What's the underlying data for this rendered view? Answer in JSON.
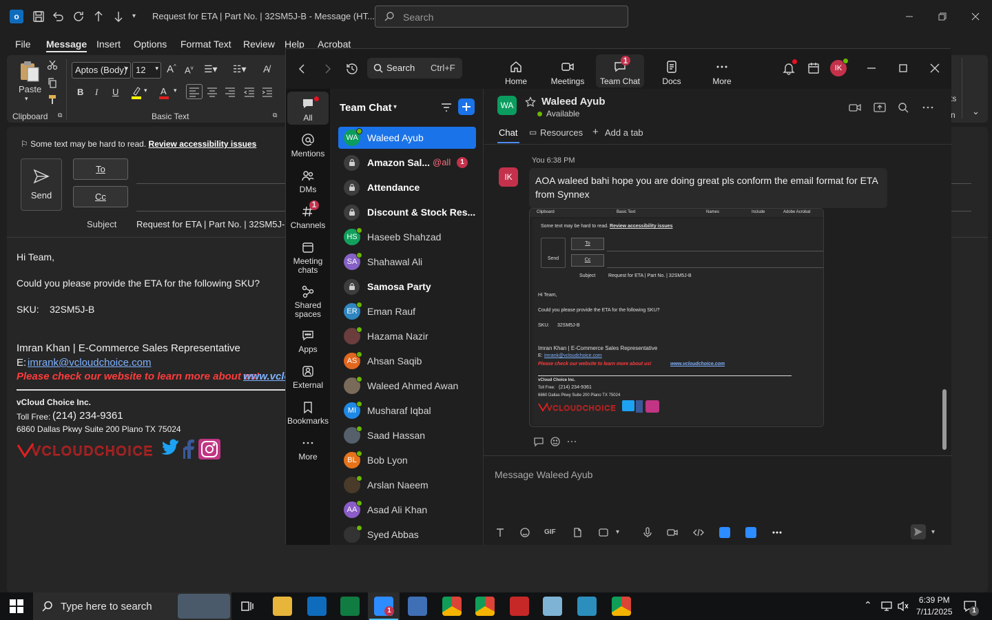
{
  "outlook": {
    "title": "Request for ETA | Part No. | 32SM5J-B  -  Message (HT...",
    "search_placeholder": "Search",
    "menu": [
      "File",
      "Message",
      "Insert",
      "Options",
      "Format Text",
      "Review",
      "Help",
      "Acrobat"
    ],
    "ribbon": {
      "paste": "Paste",
      "clipboard_group": "Clipboard",
      "basic_text_group": "Basic Text",
      "font_name": "Aptos (Body)",
      "font_size": "12",
      "right_partial": "ts",
      "right_partial2": "n"
    },
    "compose": {
      "accessibility_text": "Some text may be hard to read.",
      "accessibility_link": "Review accessibility issues",
      "send": "Send",
      "to": "To",
      "cc": "Cc",
      "subject_label": "Subject",
      "subject_value": "Request for ETA | Part No. | 32SM5J-B",
      "greeting": "Hi Team,",
      "line1": "Could you please provide the ETA for the following SKU?",
      "sku_label": "SKU:",
      "sku_value": "32SM5J-B",
      "sig_name": "Imran Khan | E-Commerce Sales Representative",
      "sig_email_label": "E:",
      "sig_email": "imrank@vcloudchoice.com",
      "sig_promo": "Please check our website to learn more about us!",
      "sig_url": "www.vclo",
      "company": "vCloud Choice Inc.",
      "toll_label": "Toll Free:",
      "toll_number": "(214) 234-9361",
      "address": "6860 Dallas Pkwy Suite 200 Plano TX 75024",
      "logo_text": "VCLOUDCHOICE"
    }
  },
  "teams": {
    "search": {
      "label": "Search",
      "shortcut": "Ctrl+F"
    },
    "apps": [
      {
        "label": "Home",
        "icon": "home-icon"
      },
      {
        "label": "Meetings",
        "icon": "video-icon"
      },
      {
        "label": "Team Chat",
        "icon": "chat-icon",
        "badge": "1"
      },
      {
        "label": "Docs",
        "icon": "doc-icon"
      },
      {
        "label": "More",
        "icon": "more-icon"
      }
    ],
    "profile_initials": "IK",
    "rail": [
      {
        "label": "All",
        "icon": "chat-icon"
      },
      {
        "label": "Mentions",
        "icon": "at-icon"
      },
      {
        "label": "DMs",
        "icon": "people-icon"
      },
      {
        "label": "Channels",
        "icon": "hash-icon",
        "badge": "1"
      },
      {
        "label": "Meeting chats",
        "icon": "calendar-icon"
      },
      {
        "label": "Shared spaces",
        "icon": "share-icon"
      },
      {
        "label": "Apps",
        "icon": "apps-icon"
      },
      {
        "label": "External",
        "icon": "external-icon"
      },
      {
        "label": "Bookmarks",
        "icon": "bookmark-icon"
      },
      {
        "label": "More",
        "icon": "more-icon"
      }
    ],
    "chat_list_title": "Team Chat",
    "chats": [
      {
        "name": "Waleed Ayub",
        "initials": "WA",
        "color": "#0b9d5f",
        "type": "person",
        "selected": true
      },
      {
        "name": "Amazon Sal...",
        "type": "channel",
        "bold": true,
        "mention": "@all",
        "badge": "1"
      },
      {
        "name": "Attendance",
        "type": "channel",
        "bold": true
      },
      {
        "name": "Discount & Stock Res...",
        "type": "channel",
        "bold": true
      },
      {
        "name": "Haseeb Shahzad",
        "initials": "HS",
        "color": "#12a05c",
        "type": "person"
      },
      {
        "name": "Shahawal Ali",
        "initials": "SA",
        "color": "#8661c5",
        "type": "person"
      },
      {
        "name": "Samosa Party",
        "type": "channel",
        "bold": true
      },
      {
        "name": "Eman Rauf",
        "initials": "ER",
        "color": "#2e86c1",
        "type": "person"
      },
      {
        "name": "Hazama Nazir",
        "initials": "",
        "color": "#6b3d3d",
        "type": "person"
      },
      {
        "name": "Ahsan Saqib",
        "initials": "AS",
        "color": "#e1671f",
        "type": "person"
      },
      {
        "name": "Waleed Ahmed Awan",
        "initials": "",
        "color": "#7a6a5a",
        "type": "person"
      },
      {
        "name": "Musharaf Iqbal",
        "initials": "MI",
        "color": "#1e88e5",
        "type": "person"
      },
      {
        "name": "Saad Hassan",
        "initials": "",
        "color": "#55606b",
        "type": "person"
      },
      {
        "name": "Bob Lyon",
        "initials": "BL",
        "color": "#e6731a",
        "type": "person"
      },
      {
        "name": "Arslan Naeem",
        "initials": "",
        "color": "#4a3a2a",
        "type": "person"
      },
      {
        "name": "Asad Ali Khan",
        "initials": "AA",
        "color": "#8a5cc7",
        "type": "person"
      },
      {
        "name": "Syed Abbas",
        "initials": "",
        "color": "#333333",
        "type": "person"
      }
    ],
    "conversation": {
      "name": "Waleed Ayub",
      "initials": "WA",
      "status": "Available",
      "tabs": [
        "Chat",
        "Resources",
        "Add a tab"
      ],
      "sender_initials": "IK",
      "meta": "You 6:38 PM",
      "message": "AOA waleed bahi hope you are doing great  pls conform the email format for ETA from Synnex",
      "composer_placeholder": "Message Waleed Ayub",
      "gif_label": "GIF"
    },
    "screenshot": {
      "g1": "Clipboard",
      "g2": "Basic Text",
      "g3": "Names",
      "g4": "Include",
      "g5": "Adobe Acrobat",
      "acc": "Some text may be hard to read.",
      "acc_link": "Review accessibility issues",
      "send": "Send",
      "to": "To",
      "cc": "Cc",
      "subject_label": "Subject",
      "subject_value": "Request for ETA | Part No. | 32SM5J-B",
      "greeting": "Hi Team,",
      "line1": "Could you please provide the ETA for the following SKU?",
      "sku": "SKU:",
      "sku_value": "32SM5J-B",
      "sig_name": "Imran Khan | E-Commerce Sales Representative",
      "email_label": "E:",
      "email": "imrank@vcloudchoice.com",
      "promo": "Please check our website to learn more about us!",
      "url": "www.vcloudchoice.com",
      "company": "vCloud Choice Inc.",
      "toll_label": "Toll Free:",
      "toll": "(214) 234-9361",
      "address": "6860 Dallas Pkwy Suite 200 Plano TX 75024",
      "logo": "VCLOUDCHOICE"
    }
  },
  "taskbar": {
    "search_placeholder": "Type here to search",
    "time": "6:39 PM",
    "date": "7/11/2025",
    "zoom_badge": "1",
    "notif_badge": "1"
  },
  "colors": {
    "accent": "#1a73e8",
    "badge": "#c4314b",
    "presence": "#6bb700",
    "brand_red": "#ff3b3b"
  }
}
